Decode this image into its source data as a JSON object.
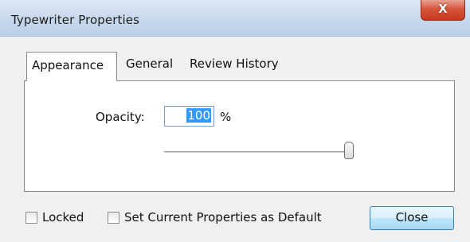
{
  "window": {
    "title": "Typewriter Properties",
    "close_glyph": "X"
  },
  "tabs": [
    {
      "label": "Appearance",
      "selected": true
    },
    {
      "label": "General",
      "selected": false
    },
    {
      "label": "Review History",
      "selected": false
    }
  ],
  "appearance": {
    "opacity_label": "Opacity:",
    "opacity_value": "100",
    "opacity_unit": "%",
    "opacity_slider_level": 1.0
  },
  "footer": {
    "locked_label": "Locked",
    "locked_checked": false,
    "default_label": "Set Current Properties as Default",
    "default_checked": false,
    "close_label": "Close"
  }
}
